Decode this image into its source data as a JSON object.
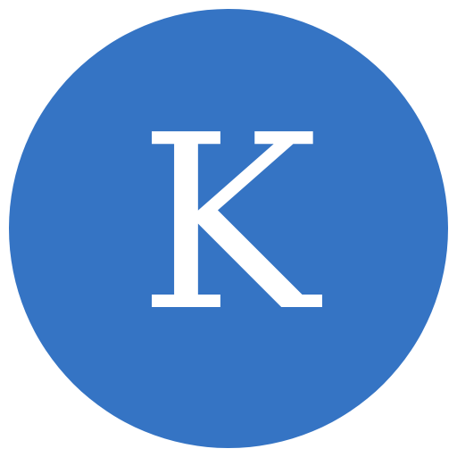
{
  "avatar": {
    "initial": "K",
    "background_color": "#3574C4",
    "text_color": "#FFFFFF"
  }
}
